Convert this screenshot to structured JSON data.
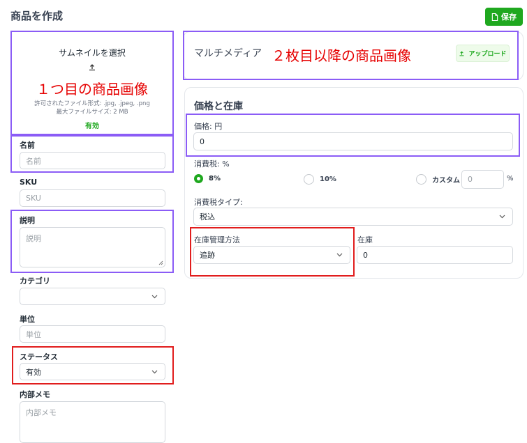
{
  "page": {
    "title": "商品を作成",
    "save_label": "保存"
  },
  "thumbnail": {
    "select_label": "サムネイルを選択",
    "allowed": "許可されたファイル形式: .jpg, .jpeg, .png",
    "max_size": "最大ファイルサイズ: 2 MB",
    "status": "有効"
  },
  "annotations": {
    "first_image": "１つ目の商品画像",
    "later_images": "２枚目以降の商品画像"
  },
  "fields": {
    "name": {
      "label": "名前",
      "placeholder": "名前"
    },
    "sku": {
      "label": "SKU",
      "placeholder": "SKU"
    },
    "description": {
      "label": "説明",
      "placeholder": "説明"
    },
    "category": {
      "label": "カテゴリ",
      "value": ""
    },
    "unit": {
      "label": "単位",
      "placeholder": "単位"
    },
    "status": {
      "label": "ステータス",
      "value": "有効"
    },
    "memo": {
      "label": "内部メモ",
      "placeholder": "内部メモ"
    }
  },
  "multimedia": {
    "title": "マルチメディア",
    "upload_label": "アップロード"
  },
  "pricing": {
    "title": "価格と在庫",
    "price_label": "価格: 円",
    "price_value": "0",
    "tax_label": "消費税: %",
    "tax_options": [
      "8%",
      "10%",
      "カスタム"
    ],
    "tax_selected": "8%",
    "custom_value": "0",
    "percent_suffix": "%",
    "tax_type_label": "消費税タイプ:",
    "tax_type_value": "税込",
    "stock_method_label": "在庫管理方法",
    "stock_method_value": "追跡",
    "stock_label": "在庫",
    "stock_value": "0"
  },
  "colors": {
    "accent": "#1fa81f",
    "annotation_purple": "#8b5cf6",
    "annotation_red": "#e11d1d"
  }
}
